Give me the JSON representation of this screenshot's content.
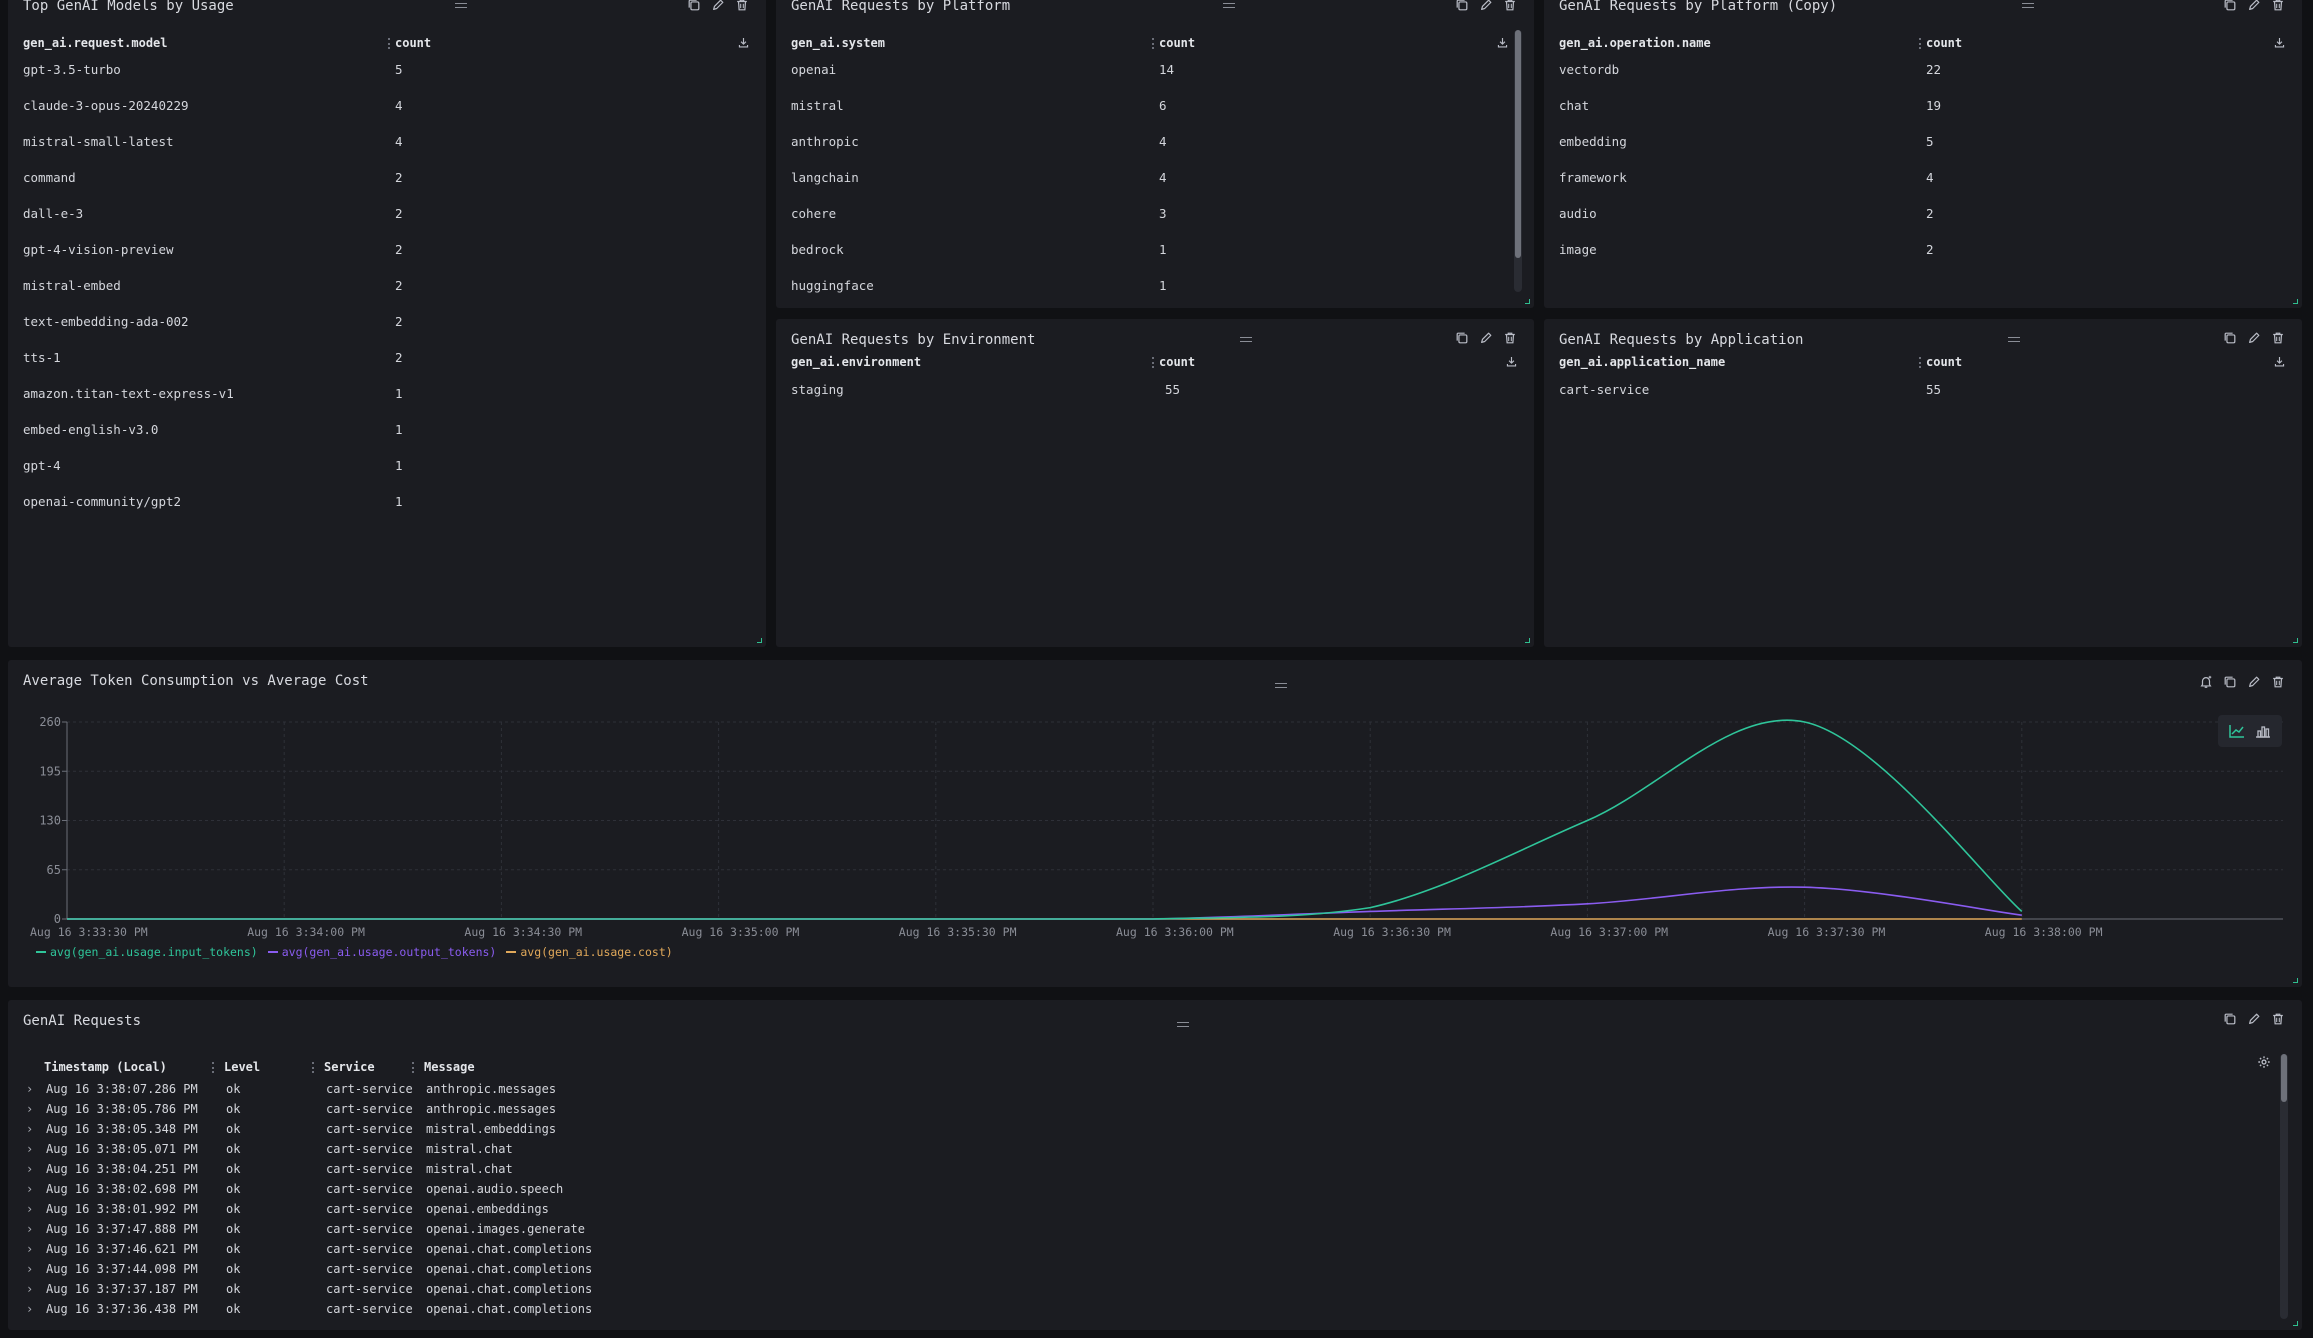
{
  "panels": {
    "models": {
      "title": "Top GenAI Models by Usage",
      "col1": "gen_ai.request.model",
      "col2": "count",
      "rows": [
        {
          "name": "gpt-3.5-turbo",
          "count": "5"
        },
        {
          "name": "claude-3-opus-20240229",
          "count": "4"
        },
        {
          "name": "mistral-small-latest",
          "count": "4"
        },
        {
          "name": "command",
          "count": "2"
        },
        {
          "name": "dall-e-3",
          "count": "2"
        },
        {
          "name": "gpt-4-vision-preview",
          "count": "2"
        },
        {
          "name": "mistral-embed",
          "count": "2"
        },
        {
          "name": "text-embedding-ada-002",
          "count": "2"
        },
        {
          "name": "tts-1",
          "count": "2"
        },
        {
          "name": "amazon.titan-text-express-v1",
          "count": "1"
        },
        {
          "name": "embed-english-v3.0",
          "count": "1"
        },
        {
          "name": "gpt-4",
          "count": "1"
        },
        {
          "name": "openai-community/gpt2",
          "count": "1"
        }
      ]
    },
    "platform": {
      "title": "GenAI Requests by Platform",
      "col1": "gen_ai.system",
      "col2": "count",
      "rows": [
        {
          "name": "openai",
          "count": "14"
        },
        {
          "name": "mistral",
          "count": "6"
        },
        {
          "name": "anthropic",
          "count": "4"
        },
        {
          "name": "langchain",
          "count": "4"
        },
        {
          "name": "cohere",
          "count": "3"
        },
        {
          "name": "bedrock",
          "count": "1"
        },
        {
          "name": "huggingface",
          "count": "1"
        }
      ]
    },
    "platform_copy": {
      "title": "GenAI Requests by Platform (Copy)",
      "col1": "gen_ai.operation.name",
      "col2": "count",
      "rows": [
        {
          "name": "vectordb",
          "count": "22"
        },
        {
          "name": "chat",
          "count": "19"
        },
        {
          "name": "embedding",
          "count": "5"
        },
        {
          "name": "framework",
          "count": "4"
        },
        {
          "name": "audio",
          "count": "2"
        },
        {
          "name": "image",
          "count": "2"
        }
      ]
    },
    "environment": {
      "title": "GenAI Requests by Environment",
      "col1": "gen_ai.environment",
      "col2": "count",
      "rows": [
        {
          "name": "staging",
          "count": "55"
        }
      ]
    },
    "application": {
      "title": "GenAI Requests by Application",
      "col1": "gen_ai.application_name",
      "col2": "count",
      "rows": [
        {
          "name": "cart-service",
          "count": "55"
        }
      ]
    }
  },
  "chart_panel": {
    "title": "Average Token Consumption vs Average Cost"
  },
  "chart_data": {
    "type": "line",
    "title": "Average Token Consumption vs Average Cost",
    "xlabel": "",
    "ylabel": "",
    "ylim": [
      0,
      260
    ],
    "yticks": [
      "0",
      "65",
      "130",
      "195",
      "260"
    ],
    "x": [
      "Aug 16 3:33:30 PM",
      "Aug 16 3:34:00 PM",
      "Aug 16 3:34:30 PM",
      "Aug 16 3:35:00 PM",
      "Aug 16 3:35:30 PM",
      "Aug 16 3:36:00 PM",
      "Aug 16 3:36:30 PM",
      "Aug 16 3:37:00 PM",
      "Aug 16 3:37:30 PM",
      "Aug 16 3:38:00 PM"
    ],
    "series": [
      {
        "name": "avg(gen_ai.usage.input_tokens)",
        "color": "#2fc59a",
        "values": [
          0,
          0,
          0,
          0,
          0,
          0,
          15,
          130,
          260,
          10
        ]
      },
      {
        "name": "avg(gen_ai.usage.output_tokens)",
        "color": "#8a5cf0",
        "values": [
          0,
          0,
          0,
          0,
          0,
          0,
          10,
          20,
          42,
          5
        ]
      },
      {
        "name": "avg(gen_ai.usage.cost)",
        "color": "#e0a85a",
        "values": [
          0,
          0,
          0,
          0,
          0,
          0,
          0,
          0,
          0,
          0
        ]
      }
    ],
    "grid": true,
    "legend": "bottom-left"
  },
  "logs": {
    "title": "GenAI Requests",
    "headers": {
      "ts": "Timestamp (Local)",
      "level": "Level",
      "service": "Service",
      "message": "Message"
    },
    "rows": [
      {
        "ts": "Aug 16 3:38:07.286 PM",
        "level": "ok",
        "service": "cart-service",
        "message": "anthropic.messages"
      },
      {
        "ts": "Aug 16 3:38:05.786 PM",
        "level": "ok",
        "service": "cart-service",
        "message": "anthropic.messages"
      },
      {
        "ts": "Aug 16 3:38:05.348 PM",
        "level": "ok",
        "service": "cart-service",
        "message": "mistral.embeddings"
      },
      {
        "ts": "Aug 16 3:38:05.071 PM",
        "level": "ok",
        "service": "cart-service",
        "message": "mistral.chat"
      },
      {
        "ts": "Aug 16 3:38:04.251 PM",
        "level": "ok",
        "service": "cart-service",
        "message": "mistral.chat"
      },
      {
        "ts": "Aug 16 3:38:02.698 PM",
        "level": "ok",
        "service": "cart-service",
        "message": "openai.audio.speech"
      },
      {
        "ts": "Aug 16 3:38:01.992 PM",
        "level": "ok",
        "service": "cart-service",
        "message": "openai.embeddings"
      },
      {
        "ts": "Aug 16 3:37:47.888 PM",
        "level": "ok",
        "service": "cart-service",
        "message": "openai.images.generate"
      },
      {
        "ts": "Aug 16 3:37:46.621 PM",
        "level": "ok",
        "service": "cart-service",
        "message": "openai.chat.completions"
      },
      {
        "ts": "Aug 16 3:37:44.098 PM",
        "level": "ok",
        "service": "cart-service",
        "message": "openai.chat.completions"
      },
      {
        "ts": "Aug 16 3:37:37.187 PM",
        "level": "ok",
        "service": "cart-service",
        "message": "openai.chat.completions"
      },
      {
        "ts": "Aug 16 3:37:36.438 PM",
        "level": "ok",
        "service": "cart-service",
        "message": "openai.chat.completions"
      }
    ]
  }
}
